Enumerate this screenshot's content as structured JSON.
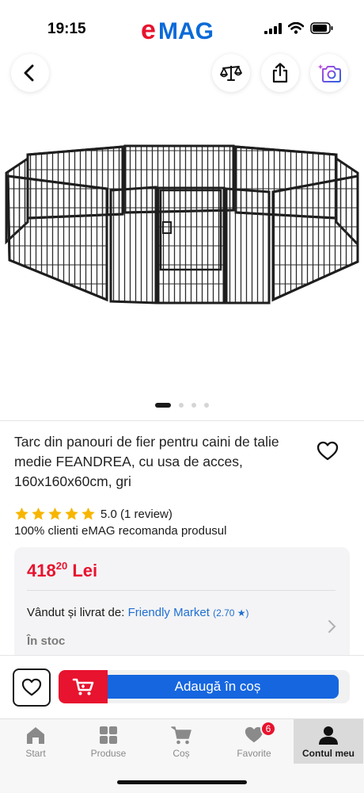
{
  "status_bar": {
    "time": "19:15",
    "icons": [
      "signal-icon",
      "wifi-icon",
      "battery-icon"
    ]
  },
  "brand": {
    "logo_e": "e",
    "logo_mag": "MAG",
    "colors": {
      "red": "#e8132e",
      "blue": "#0b6ad8"
    }
  },
  "top_actions": {
    "icons": [
      "back-icon",
      "compare-icon",
      "share-icon",
      "camera-search-icon"
    ]
  },
  "gallery": {
    "image": "dog-playpen-image",
    "dots_total": 4,
    "active_index": 0
  },
  "product": {
    "title": "Tarc din panouri de fier pentru caini de talie medie FEANDREA, cu usa de acces, 160x160x60cm, gri",
    "rating_stars": 5,
    "rating_text": "5.0 (1 review)",
    "recommend": "100% clienti eMAG recomanda produsul"
  },
  "offer": {
    "price_int": "418",
    "price_dec": "20",
    "currency": "Lei",
    "seller_label": "Vândut și livrat de: ",
    "seller_name": "Friendly Market",
    "seller_score": "(2.70 ★)",
    "stock": "În stoc"
  },
  "actions": {
    "add_to_cart": "Adaugă în coș"
  },
  "tabs": [
    {
      "label": "Start",
      "icon": "home-icon"
    },
    {
      "label": "Produse",
      "icon": "grid-icon"
    },
    {
      "label": "Coș",
      "icon": "cart-icon"
    },
    {
      "label": "Favorite",
      "icon": "heart-icon",
      "badge": "6"
    },
    {
      "label": "Contul meu",
      "icon": "user-icon",
      "active": true
    }
  ]
}
